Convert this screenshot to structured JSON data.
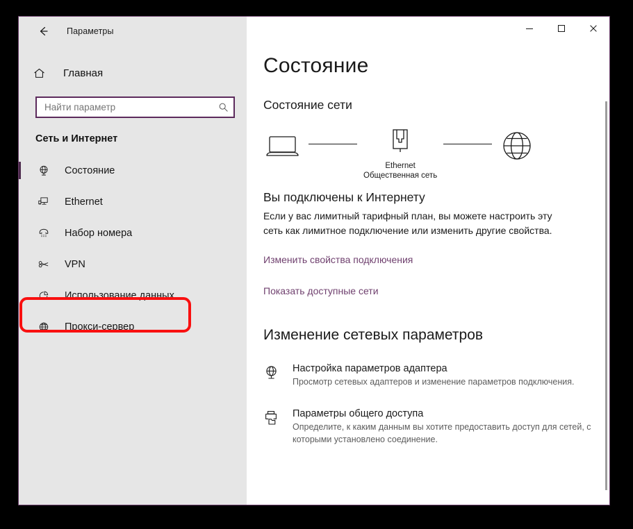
{
  "window": {
    "title": "Параметры",
    "back_icon": "back-arrow-icon",
    "controls": {
      "minimize": "—",
      "maximize": "□",
      "close": "✕"
    }
  },
  "sidebar": {
    "home_label": "Главная",
    "home_icon": "home-icon",
    "search": {
      "placeholder": "Найти параметр",
      "value": "",
      "icon": "search-icon"
    },
    "section_title": "Сеть и Интернет",
    "items": [
      {
        "label": "Состояние",
        "icon": "globe-status-icon",
        "selected": true
      },
      {
        "label": "Ethernet",
        "icon": "ethernet-icon",
        "selected": false
      },
      {
        "label": "Набор номера",
        "icon": "dialup-phone-icon",
        "selected": false
      },
      {
        "label": "VPN",
        "icon": "vpn-key-icon",
        "selected": false
      },
      {
        "label": "Использование данных",
        "icon": "data-usage-pie-icon",
        "selected": false,
        "annotated": true
      },
      {
        "label": "Прокси-сервер",
        "icon": "proxy-globe-icon",
        "selected": false
      }
    ]
  },
  "main": {
    "page_title": "Состояние",
    "network_status_heading": "Состояние сети",
    "diagram": {
      "device_icon": "laptop-icon",
      "adapter_icon": "ethernet-port-icon",
      "internet_icon": "globe-icon",
      "adapter_name": "Ethernet",
      "network_type": "Общественная сеть"
    },
    "connection_heading": "Вы подключены к Интернету",
    "connection_description": "Если у вас лимитный тарифный план, вы можете настроить эту сеть как лимитное подключение или изменить другие свойства.",
    "link_change_properties": "Изменить свойства подключения",
    "link_show_networks": "Показать доступные сети",
    "changes_heading": "Изменение сетевых параметров",
    "settings": [
      {
        "title": "Настройка параметров адаптера",
        "description": "Просмотр сетевых адаптеров и изменение параметров подключения.",
        "icon": "network-adapter-icon"
      },
      {
        "title": "Параметры общего доступа",
        "description": "Определите, к каким данным вы хотите предоставить доступ для сетей, с которыми установлено соединение.",
        "icon": "sharing-printer-folder-icon"
      }
    ]
  },
  "annotation": {
    "color": "#f91010",
    "target": "Использование данных"
  }
}
